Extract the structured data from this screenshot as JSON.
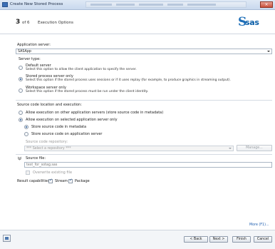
{
  "window": {
    "title": "Create New Stored Process",
    "close_glyph": "×",
    "icon": "window-icon"
  },
  "header": {
    "step_number": "3",
    "step_of": "of 6",
    "step_title": "Execution Options",
    "logo_text": "sas",
    "logo_mark": "S"
  },
  "application_server": {
    "label": "Application server:",
    "value": "SASApp"
  },
  "server_type": {
    "label": "Server type:",
    "options": [
      {
        "title": "Default server",
        "description": "Select this option to allow the client application to specify the server.",
        "selected": false
      },
      {
        "title": "Stored process server only",
        "description": "Select this option if the stored process uses sessions or if it uses replay (for example, to produce graphics in streaming output).",
        "selected": true
      },
      {
        "title": "Workspace server only",
        "description": "Select this option if the stored process must be run under the client identity.",
        "selected": false
      }
    ]
  },
  "source_code": {
    "label": "Source code location and execution:",
    "allow_other": "Allow execution on other application servers (store source code in metadata)",
    "allow_selected": "Allow execution on selected application server only",
    "store_metadata": "Store source code in metadata",
    "store_app_server": "Store source code on application server",
    "repository_label": "Source code repository:",
    "repository_placeholder": "*** Select a repository ***",
    "manage_button": "Manage...",
    "source_file_label": "Source file:",
    "source_file_value": "test_for_sotag.sas",
    "overwrite_label": "Overwrite existing file"
  },
  "result_capabilities": {
    "label": "Result capabilities:",
    "stream": "Stream",
    "package": "Package",
    "stream_checked": true,
    "package_checked": true
  },
  "footer": {
    "more_link": "More (F1)...",
    "back_button": "< Back",
    "next_button": "Next >",
    "finish_button": "Finish",
    "cancel_button": "Cancel"
  }
}
